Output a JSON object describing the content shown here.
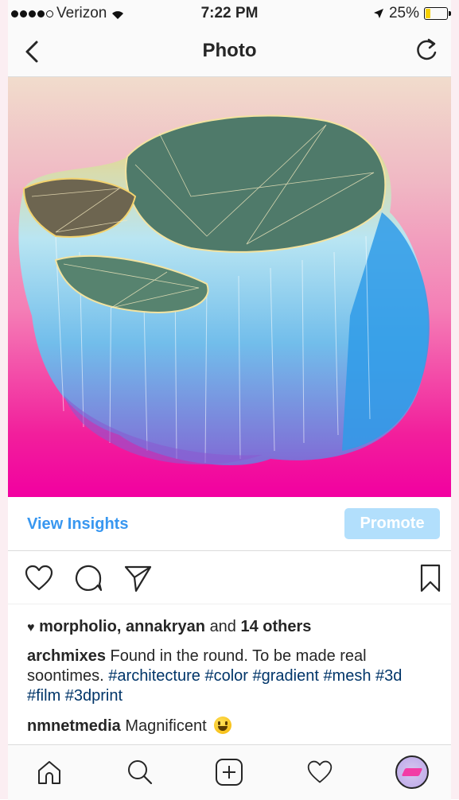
{
  "status_bar": {
    "carrier": "Verizon",
    "time": "7:22 PM",
    "battery": "25%",
    "battery_level": 0.25
  },
  "nav": {
    "title": "Photo",
    "back_icon": "chevron-left-icon",
    "refresh_icon": "refresh-icon"
  },
  "actions": {
    "view_insights": "View Insights",
    "promote": "Promote"
  },
  "post": {
    "likes": {
      "names": "morpholio, annakryan",
      "and": "and",
      "count": "14 others"
    },
    "caption": {
      "username": "archmixes",
      "text": "Found in the round. To be made real soontimes.",
      "hashtags": "#architecture #color #gradient #mesh #3d #film #3dprint"
    },
    "comment": {
      "username": "nmnetmedia",
      "text": "Magnificent"
    }
  },
  "tab_bar": [
    "home-icon",
    "search-icon",
    "add-icon",
    "heart-icon",
    "profile-avatar"
  ],
  "colors": {
    "link": "#3897f0",
    "promote_bg": "#b2dffc",
    "hashtag": "#003569",
    "photo_top": "#f1dccc",
    "photo_bottom": "#f200a0"
  }
}
